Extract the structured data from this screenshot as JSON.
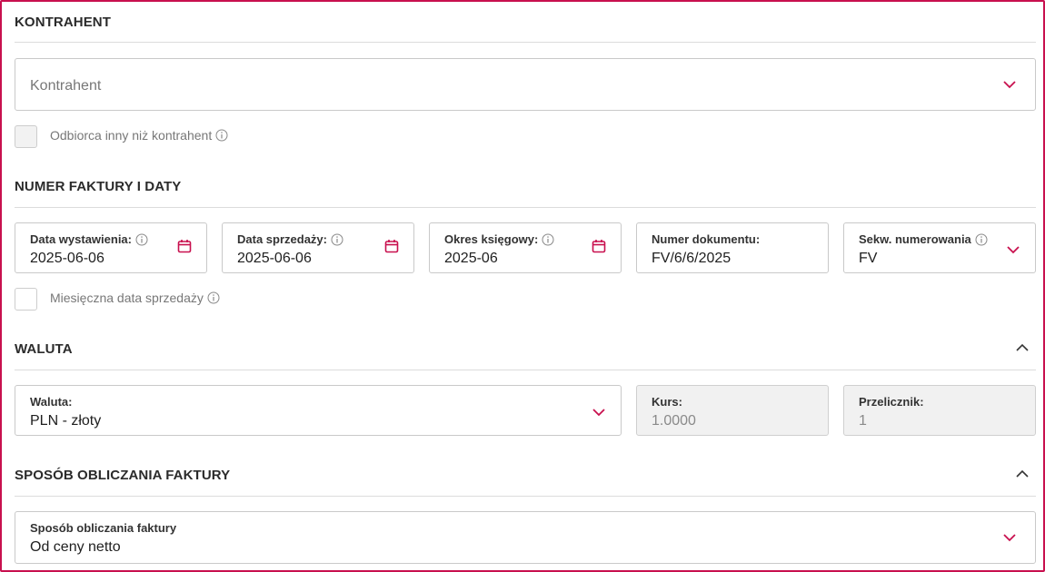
{
  "colors": {
    "accent": "#c8104e",
    "border": "#c9c9c9",
    "disabled_bg": "#f1f1f1"
  },
  "sections": {
    "kontrahent": {
      "title": "KONTRAHENT",
      "select_placeholder": "Kontrahent",
      "checkbox_label": "Odbiorca inny niż kontrahent"
    },
    "numer": {
      "title": "NUMER FAKTURY I DATY",
      "fields": [
        {
          "label": "Data wystawienia:",
          "value": "2025-06-06",
          "icon": "calendar-icon",
          "info": true
        },
        {
          "label": "Data sprzedaży:",
          "value": "2025-06-06",
          "icon": "calendar-icon",
          "info": true
        },
        {
          "label": "Okres księgowy:",
          "value": "2025-06",
          "icon": "calendar-icon",
          "info": true
        },
        {
          "label": "Numer dokumentu:",
          "value": "FV/6/6/2025",
          "info": false
        },
        {
          "label": "Sekw. numerowania",
          "value": "FV",
          "icon": "chevron-down-icon",
          "info": true
        }
      ],
      "checkbox_label": "Miesięczna data sprzedaży"
    },
    "waluta": {
      "title": "WALUTA",
      "currency_label": "Waluta:",
      "currency_value": "PLN - złoty",
      "rate_label": "Kurs:",
      "rate_value": "1.0000",
      "converter_label": "Przelicznik:",
      "converter_value": "1"
    },
    "sposob": {
      "title": "SPOSÓB OBLICZANIA FAKTURY",
      "method_label": "Sposób obliczania faktury",
      "method_value": "Od ceny netto"
    }
  }
}
